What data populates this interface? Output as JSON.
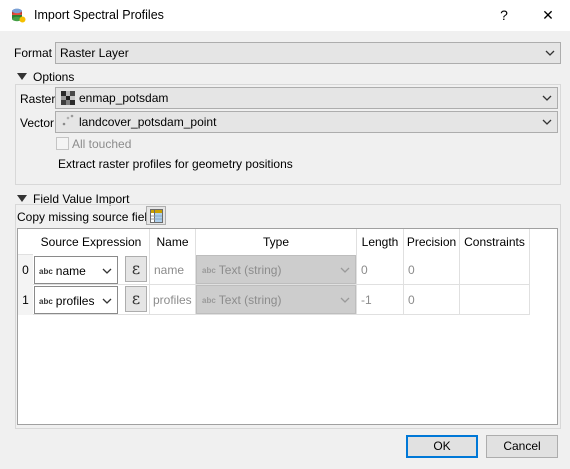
{
  "window": {
    "title": "Import Spectral Profiles",
    "help_symbol": "?",
    "close_symbol": "✕"
  },
  "format": {
    "label": "Format",
    "value": "Raster Layer"
  },
  "options": {
    "header": "Options",
    "raster_label": "Raster",
    "raster_value": "enmap_potsdam",
    "vector_label": "Vector",
    "vector_value": "landcover_potsdam_point",
    "all_touched_label": "All touched",
    "all_touched_checked": false,
    "description": "Extract raster profiles for geometry positions"
  },
  "field_value_import": {
    "header": "Field Value Import",
    "copy_label": "Copy missing source fields"
  },
  "table": {
    "columns": [
      "Source Expression",
      "Name",
      "Type",
      "Length",
      "Precision",
      "Constraints"
    ],
    "rows": [
      {
        "index": "0",
        "source": "name",
        "name": "name",
        "type": "Text (string)",
        "length": "0",
        "precision": "0",
        "constraints": ""
      },
      {
        "index": "1",
        "source": "profiles",
        "name": "profiles",
        "type": "Text (string)",
        "length": "-1",
        "precision": "0",
        "constraints": ""
      }
    ],
    "abc_tag": "abc",
    "expr_symbol": "ε"
  },
  "buttons": {
    "ok": "OK",
    "cancel": "Cancel"
  }
}
